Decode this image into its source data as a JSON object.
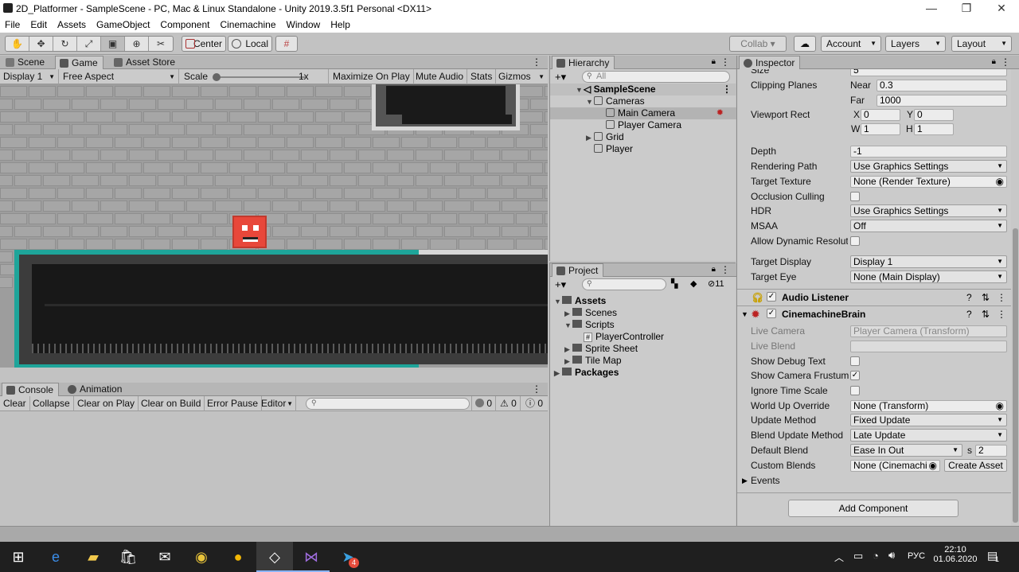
{
  "window": {
    "title": "2D_Platformer - SampleScene - PC, Mac & Linux Standalone - Unity 2019.3.5f1 Personal <DX11>",
    "minimize": "—",
    "maximize": "❐",
    "close": "✕"
  },
  "menu": [
    "File",
    "Edit",
    "Assets",
    "GameObject",
    "Component",
    "Cinemachine",
    "Window",
    "Help"
  ],
  "toolbar": {
    "center_label": "Center",
    "local_label": "Local",
    "collab_label": "Collab ▾",
    "account_label": "Account",
    "layers_label": "Layers",
    "layout_label": "Layout"
  },
  "scene_panel": {
    "tabs": [
      "Scene",
      "Game",
      "Asset Store"
    ],
    "display": "Display 1",
    "aspect": "Free Aspect",
    "scale_label": "Scale",
    "scale_value": "1x",
    "maximize": "Maximize On Play",
    "mute": "Mute Audio",
    "stats": "Stats",
    "gizmos": "Gizmos"
  },
  "console": {
    "tabs": [
      "Console",
      "Animation"
    ],
    "clear": "Clear",
    "collapse": "Collapse",
    "clear_on_play": "Clear on Play",
    "clear_on_build": "Clear on Build",
    "error_pause": "Error Pause",
    "editor": "Editor",
    "count_info": "0",
    "count_warn": "0",
    "count_error": "0"
  },
  "hierarchy": {
    "tab": "Hierarchy",
    "search_placeholder": "All",
    "scene": "SampleScene",
    "cameras": "Cameras",
    "main_camera": "Main Camera",
    "player_camera": "Player Camera",
    "grid": "Grid",
    "player": "Player"
  },
  "project": {
    "tab": "Project",
    "count": "11",
    "assets": "Assets",
    "scenes": "Scenes",
    "scripts": "Scripts",
    "player_controller": "PlayerController",
    "sprite_sheet": "Sprite Sheet",
    "tile_map": "Tile Map",
    "packages": "Packages"
  },
  "inspector": {
    "tab": "Inspector",
    "size_label": "Size",
    "size_value": "5",
    "clipping_label": "Clipping Planes",
    "near_label": "Near",
    "near_value": "0.3",
    "far_label": "Far",
    "far_value": "1000",
    "viewport_label": "Viewport Rect",
    "x_label": "X",
    "x_value": "0",
    "y_label": "Y",
    "y_value": "0",
    "w_label": "W",
    "w_value": "1",
    "h_label": "H",
    "h_value": "1",
    "depth_label": "Depth",
    "depth_value": "-1",
    "rendering_path_label": "Rendering Path",
    "rendering_path_value": "Use Graphics Settings",
    "target_texture_label": "Target Texture",
    "target_texture_value": "None (Render Texture)",
    "occlusion_label": "Occlusion Culling",
    "hdr_label": "HDR",
    "hdr_value": "Use Graphics Settings",
    "msaa_label": "MSAA",
    "msaa_value": "Off",
    "dynres_label": "Allow Dynamic Resolut",
    "target_display_label": "Target Display",
    "target_display_value": "Display 1",
    "target_eye_label": "Target Eye",
    "target_eye_value": "None (Main Display)",
    "audio_listener": "Audio Listener",
    "cinemachine_brain": "CinemachineBrain",
    "live_camera_label": "Live Camera",
    "live_camera_value": "Player Camera (Transform)",
    "live_blend_label": "Live Blend",
    "debug_text_label": "Show Debug Text",
    "frustum_label": "Show Camera Frustum",
    "ignore_time_label": "Ignore Time Scale",
    "world_up_label": "World Up Override",
    "world_up_value": "None (Transform)",
    "update_method_label": "Update Method",
    "update_method_value": "Fixed Update",
    "blend_update_label": "Blend Update Method",
    "blend_update_value": "Late Update",
    "default_blend_label": "Default Blend",
    "default_blend_value": "Ease In Out",
    "blend_s_label": "s",
    "blend_s_value": "2",
    "custom_blends_label": "Custom Blends",
    "custom_blends_value": "None (Cinemachi",
    "create_asset": "Create Asset",
    "events": "Events",
    "add_component": "Add Component"
  },
  "taskbar": {
    "language": "РУС",
    "time": "22:10",
    "date": "01.06.2020",
    "telegram_badge": "4",
    "notification_count": "1"
  }
}
